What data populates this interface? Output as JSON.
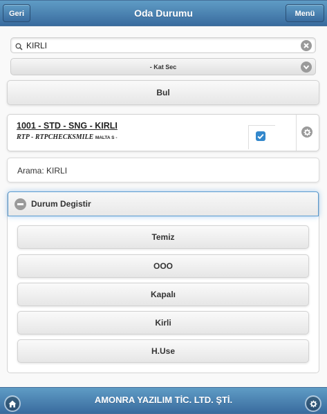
{
  "header": {
    "title": "Oda Durumu",
    "back_label": "Geri",
    "menu_label": "Menü"
  },
  "search": {
    "value": "KIRLI",
    "placeholder": ""
  },
  "floor_select": {
    "selected": "- Kat Sec"
  },
  "find_button": "Bul",
  "room": {
    "title": "1001 - STD - SNG - KIRLI",
    "subtitle": "RTP - RTPCHECKSMILE",
    "subtitle_small": "MALTA S -",
    "checked": true
  },
  "search_label": "Arama: KIRLI",
  "status_section": {
    "title": "Durum Degistir",
    "expanded": true,
    "options": [
      "Temiz",
      "OOO",
      "Kapalı",
      "Kirli",
      "H.Use"
    ]
  },
  "footer": {
    "title": "AMONRA YAZILIM TİC. LTD. ŞTİ."
  },
  "colors": {
    "bar": "#4a83b4",
    "accent": "#3388cc",
    "icon_gray": "#9a9a9a"
  }
}
